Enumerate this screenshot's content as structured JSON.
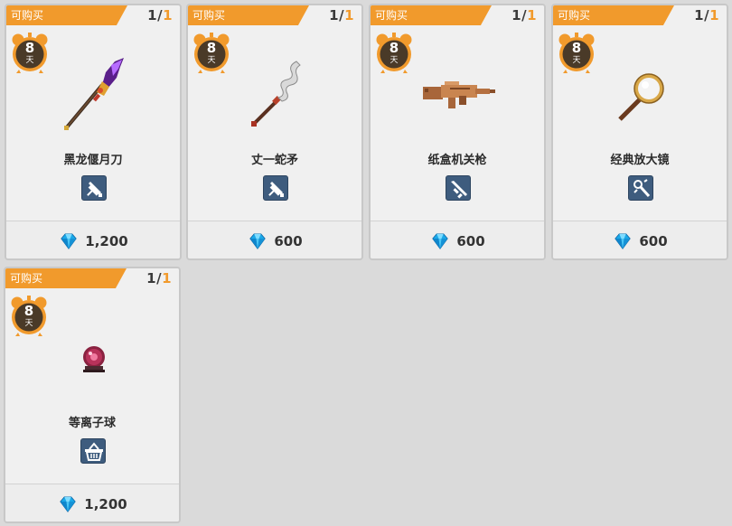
{
  "shop": {
    "items": [
      {
        "badge": "可购买",
        "stock_current": "1",
        "stock_sep": "/",
        "stock_max": "1",
        "days": "8",
        "days_unit": "天",
        "name": "黑龙偃月刀",
        "type_icon": "sword-icon",
        "price": "1,200"
      },
      {
        "badge": "可购买",
        "stock_current": "1",
        "stock_sep": "/",
        "stock_max": "1",
        "days": "8",
        "days_unit": "天",
        "name": "丈一蛇矛",
        "type_icon": "sword-icon",
        "price": "600"
      },
      {
        "badge": "可购买",
        "stock_current": "1",
        "stock_sep": "/",
        "stock_max": "1",
        "days": "8",
        "days_unit": "天",
        "name": "纸盒机关枪",
        "type_icon": "gun-icon",
        "price": "600"
      },
      {
        "badge": "可购买",
        "stock_current": "1",
        "stock_sep": "/",
        "stock_max": "1",
        "days": "8",
        "days_unit": "天",
        "name": "经典放大镜",
        "type_icon": "staff-icon",
        "price": "600"
      },
      {
        "badge": "可购买",
        "stock_current": "1",
        "stock_sep": "/",
        "stock_max": "1",
        "days": "8",
        "days_unit": "天",
        "name": "等离子球",
        "type_icon": "basket-icon",
        "price": "1,200"
      }
    ],
    "currency_icon": "gem-icon"
  },
  "colors": {
    "accent_orange": "#f19a2c",
    "badge_blue": "#3e5c7e",
    "gem_blue": "#1aa8e8",
    "clock_dark": "#4a3a28"
  }
}
